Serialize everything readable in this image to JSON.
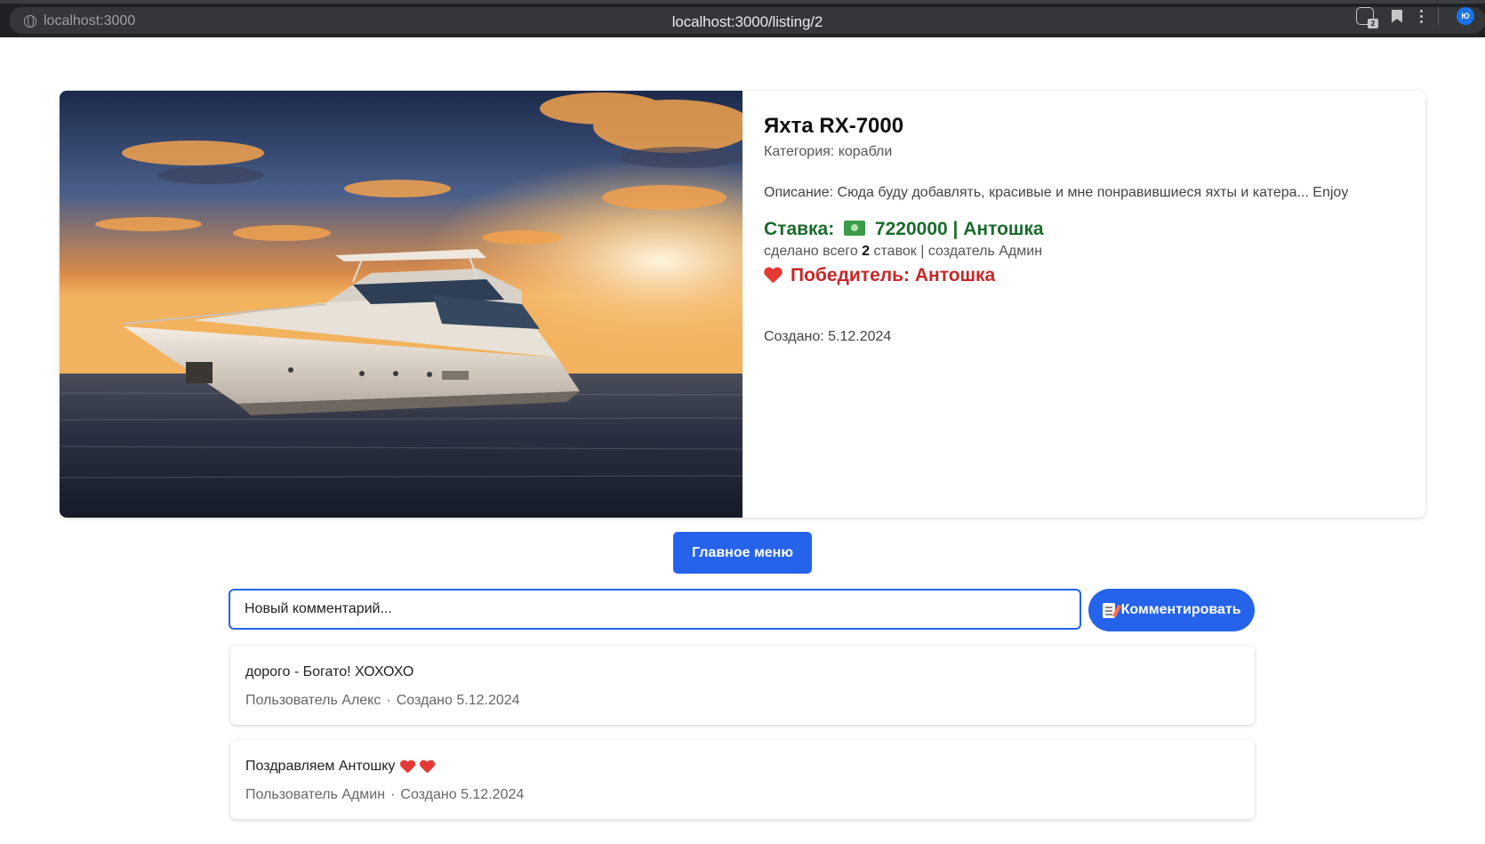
{
  "browser": {
    "site_chip": "localhost:3000",
    "url": "localhost:3000/listing/2",
    "extension_badge": "2",
    "profile_initials": "Ю"
  },
  "listing": {
    "title": "Яхта RX-7000",
    "category": "Категория: корабли",
    "description": "Описание: Сюда буду добавлять, красивые и мне понравившиеся яхты и катера... Enjoy",
    "bid_label": "Ставка:",
    "bid_value": "7220000 | Антошка",
    "bids_prefix": "сделано всего",
    "bids_count": "2",
    "bids_suffix": "ставок | создатель Админ",
    "winner": "Победитель: Антошка",
    "created": "Создано: 5.12.2024"
  },
  "actions": {
    "main_menu": "Главное меню",
    "comment_placeholder": "Новый комментарий...",
    "comment_button": "Комментировать"
  },
  "comments": [
    {
      "text": "дорого - Богато! ХОХОХО",
      "hearts": 0,
      "author": "Пользователь Алекс",
      "created": "Создано 5.12.2024"
    },
    {
      "text": "Поздравляем Антошку",
      "hearts": 2,
      "author": "Пользователь Админ",
      "created": "Создано 5.12.2024"
    }
  ],
  "colors": {
    "accent": "#2563eb",
    "bid_green": "#1a6b2c",
    "winner_red": "#c62828"
  }
}
